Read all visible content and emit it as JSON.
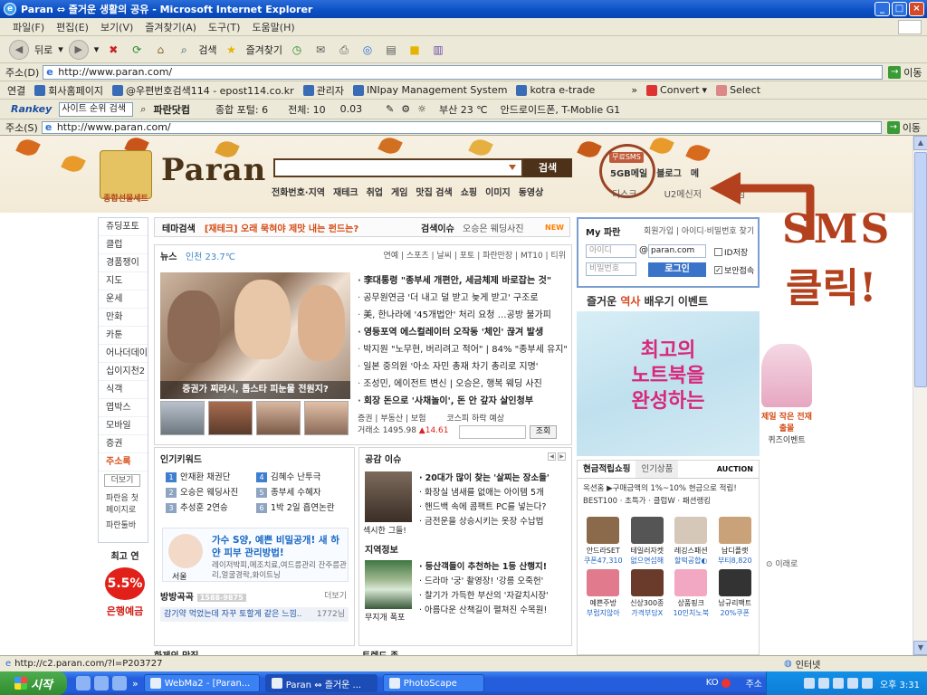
{
  "window": {
    "title": "Paran ⇔ 즐거운 생활의 공유 - Microsoft Internet Explorer"
  },
  "menu": [
    "파일(F)",
    "편집(E)",
    "보기(V)",
    "즐겨찾기(A)",
    "도구(T)",
    "도움말(H)"
  ],
  "toolbar": {
    "back": "뒤로",
    "search": "검색",
    "favorites": "즐겨찾기"
  },
  "address": {
    "label": "주소(D)",
    "url": "http://www.paran.com/",
    "go": "이동"
  },
  "links": {
    "label": "연결",
    "items": [
      "회사홈페이지",
      "@우편번호검색114 - epost114.co.kr",
      "관리자",
      "INIpay Management System",
      "kotra e-trade"
    ],
    "convert": "Convert",
    "select": "Select"
  },
  "rankbar": {
    "logo": "Rankey",
    "select": "사이트 순위 검색",
    "site": "파란닷컴",
    "rank": "종합 포털: 6",
    "total": "전체: 10",
    "pct": "0.03",
    "weather": "부산 23 ℃",
    "news": "안드로이드폰, T-Moblie G1"
  },
  "address2": {
    "label": "주소(S)",
    "url": "http://www.paran.com/",
    "go": "이동"
  },
  "paran": {
    "logo": "Paran",
    "gift_caption": "종합선물세트",
    "search_button": "검색",
    "nav": [
      "전화번호·지역",
      "재테크",
      "취업",
      "게임",
      "맛집 검색",
      "쇼핑",
      "이미지",
      "동영상"
    ],
    "sms_tag": "무료SMS",
    "top_links": [
      "5GB메일",
      "블로그",
      "메"
    ],
    "sub_links": [
      "디스크",
      "U2메신저",
      "게임"
    ]
  },
  "annotation": {
    "line1": "SMS",
    "line2": "클릭!"
  },
  "leftnav": {
    "items": [
      "쥬딩포토",
      "클럽",
      "경품쟁이",
      "지도",
      "운세",
      "만화",
      "카툰",
      "어나더데이",
      "십이지천2",
      "식객",
      "엽박스",
      "모바일",
      "증권",
      "주소록"
    ],
    "more": "더보기",
    "extra": [
      "파란음 첫페이지로",
      "파란툴바"
    ]
  },
  "bank_ad": {
    "title": "최고 연",
    "rate": "5.5%",
    "name": "은행예금"
  },
  "theme": {
    "label": "테마검색",
    "headline": "[재테크] 오래 묵혀야 제맛 내는 펀드는?",
    "issue": "검색이슈",
    "issue_item": "오승은 웨딩사진",
    "new": "NEW"
  },
  "news": {
    "title": "뉴스",
    "weather": "인천 23.7℃",
    "tabs": "연예 | 스포츠 | 날씨 | 포토 | 파란만장 | MT10 | 티위",
    "photo_caption": "증권가 찌라시, 톱스타 피눈물 전원지?",
    "items": [
      {
        "t": "李대통령 \"종부세 개편안, 세금체제 바로잡는 것\"",
        "b": true
      },
      {
        "t": "공무원연금 '더 내고 덜 받고 늦게 받고' 구조로",
        "b": false
      },
      {
        "t": "美, 한나라에 '45개법안' 처리 요청 …공방 불가피",
        "b": false
      },
      {
        "t": "영등포역 에스컬레이터 오작동 '체인' 끊겨 발생",
        "b": true
      },
      {
        "t": "박지원 \"노무현, 버리려고 적어\" | 84% \"종부세 유지\"",
        "b": false
      },
      {
        "t": "일본 중의원 '아소 자민 총재 차기 총리로 지명'",
        "b": false
      },
      {
        "t": "조성민, 에이전트 변신 | 오승은, 행복 웨딩 사진",
        "b": false
      },
      {
        "t": "회장 돈으로 '사채놀이', 돈 안 갚자 살인청부",
        "b": true
      }
    ],
    "stock_tabs": "증권 | 부동산 | 보험",
    "stock_title": "코스피 하락 예상",
    "stock_value": "거래소 1495.98",
    "stock_change": "▲14.61",
    "stock_btn": "조회"
  },
  "keywords": {
    "title": "인기키워드",
    "items": [
      "안재환 채권단",
      "김혜수 난투극",
      "오승은 웨딩사진",
      "종부세 수혜자",
      "추성훈 2연승",
      "1박 2일 흡연논란"
    ]
  },
  "ad_box": {
    "headline": "가수 S양, 예쁜 비밀공개! 새 하얀 피부 관리방법!",
    "sub": "레이저박피,메조치료,여드름관리 잔주름관리,얼굴경락,화이트닝",
    "caption": "서울"
  },
  "bbs": {
    "title": "방방곡곡",
    "tag": "1588-9875",
    "more": "더보기",
    "line": "감기약 먹었는데 자꾸 토할게 같은 느낌..",
    "line_right": "1772님"
  },
  "bottom_left": {
    "photo_title": "화제의 맛집",
    "trend_title": "트렌드 존"
  },
  "issue": {
    "title": "공감 이슈",
    "items": [
      "20대가 많이 찾는 '살찌는 장소들'",
      "화장실 냄새를 없애는 아이템 5개",
      "핸드백 속에 콤팩트 PC를 넣는다?",
      "금전운을 상승시키는 옷장 수납법"
    ],
    "caption1": "섹시한 그들!",
    "region_title": "지역정보",
    "region_items": [
      "등산객들이 추천하는 1등 산행지!",
      "드라마 '궁' 촬영장! '강릉 오죽헌'",
      "찰기가 가득한 부산의 '자갈치시장'",
      "아름다운 산책길이 펼쳐진 수목원!"
    ],
    "caption2": "무지개 폭포"
  },
  "login": {
    "title": "My 파란",
    "links": "회원가입 | 아이디·비밀번호 찾기",
    "id_placeholder": "아이디",
    "domain": "paran.com",
    "pw_placeholder": "비밀번호",
    "login_btn": "로그인",
    "id_save": "ID저장",
    "secure": "보안접속"
  },
  "history": {
    "pre": "즐거운 ",
    "hl": "역사",
    "post": " 배우기 이벤트"
  },
  "laptop_ad": {
    "line1": "최고의",
    "line2": "노트북을",
    "line3": "완성하는"
  },
  "side_ad": {
    "line1": "제일 작은 전재 출몰",
    "line2": "퀴즈이벤트"
  },
  "shop": {
    "tab1": "현금적립쇼핑",
    "tab2": "인기상품",
    "auction": "AUCTION",
    "promo": "옥션홈 ▶구매금액의 1%~10% 현금으로 적립!",
    "cats": "BEST100 · 초특가 · 클럽W · 패션랭킹",
    "products": [
      {
        "n": "안드라SET",
        "p": "쿠폰47,310",
        "c": "#8a6a4a"
      },
      {
        "n": "테일러자켓",
        "p": "없으면섭해",
        "c": "#555"
      },
      {
        "n": "레깅스패션",
        "p": "할떡공합◐",
        "c": "#d5c8b8"
      },
      {
        "n": "납디플랫",
        "p": "부티8,820",
        "c": "#c9a27a"
      },
      {
        "n": "예쁜주방",
        "p": "부럽지않아",
        "c": "#e07a8c"
      },
      {
        "n": "신상300종",
        "p": "가격부담X",
        "c": "#6a3a2a"
      },
      {
        "n": "상품핑크",
        "p": "10인치노북",
        "c": "#f2a7c2"
      },
      {
        "n": "남규리팩트",
        "p": "20%쿠폰",
        "c": "#333"
      }
    ]
  },
  "scroll_up": "이래로",
  "status": {
    "url": "http://c2.paran.com/?l=P203727",
    "zone": "인터넷"
  },
  "taskbar": {
    "start": "시작",
    "tasks": [
      "WebMa2 - [Paran...",
      "Paran ⇔ 즐거운 ...",
      "PhotoScape"
    ],
    "lang": "KO",
    "addr": "주소",
    "time": "오후 3:31"
  }
}
